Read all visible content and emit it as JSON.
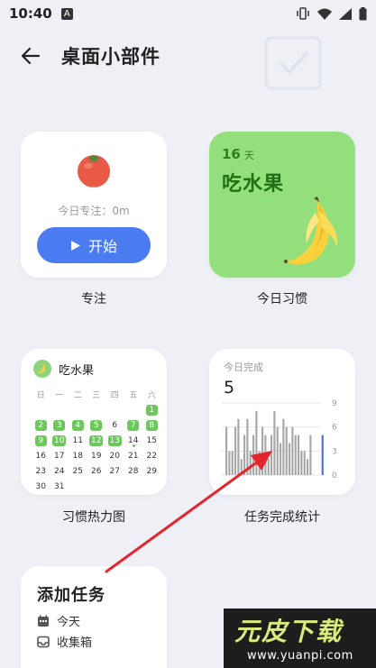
{
  "status_bar": {
    "time": "10:40",
    "notif_badge": "A"
  },
  "header": {
    "title": "桌面小部件"
  },
  "widgets": {
    "focus": {
      "caption": "专注",
      "focus_text": "今日专注：0m",
      "start_label": "开始"
    },
    "habit": {
      "caption": "今日习惯",
      "days": "16",
      "days_unit": "天",
      "name": "吃水果",
      "bg_color": "#92df7c"
    },
    "heatmap": {
      "caption": "习惯热力图",
      "title": "吃水果",
      "weekdays": [
        "日",
        "一",
        "二",
        "三",
        "四",
        "五",
        "六"
      ],
      "weeks": [
        [
          {
            "d": "",
            "done": false
          },
          {
            "d": "",
            "done": false
          },
          {
            "d": "",
            "done": false
          },
          {
            "d": "",
            "done": false
          },
          {
            "d": "",
            "done": false
          },
          {
            "d": "",
            "done": false
          },
          {
            "d": "1",
            "done": true
          }
        ],
        [
          {
            "d": "2",
            "done": true
          },
          {
            "d": "3",
            "done": true
          },
          {
            "d": "4",
            "done": true
          },
          {
            "d": "5",
            "done": true
          },
          {
            "d": "6",
            "done": false
          },
          {
            "d": "7",
            "done": true
          },
          {
            "d": "8",
            "done": true
          }
        ],
        [
          {
            "d": "9",
            "done": true
          },
          {
            "d": "10",
            "done": true
          },
          {
            "d": "11",
            "done": false
          },
          {
            "d": "12",
            "done": true
          },
          {
            "d": "13",
            "done": true
          },
          {
            "d": "14",
            "done": false,
            "today": true
          },
          {
            "d": "15",
            "done": false
          }
        ],
        [
          {
            "d": "16",
            "done": false
          },
          {
            "d": "17",
            "done": false
          },
          {
            "d": "18",
            "done": false
          },
          {
            "d": "19",
            "done": false
          },
          {
            "d": "20",
            "done": false
          },
          {
            "d": "21",
            "done": false
          },
          {
            "d": "22",
            "done": false
          }
        ],
        [
          {
            "d": "23",
            "done": false
          },
          {
            "d": "24",
            "done": false
          },
          {
            "d": "25",
            "done": false
          },
          {
            "d": "26",
            "done": false
          },
          {
            "d": "27",
            "done": false
          },
          {
            "d": "28",
            "done": false
          },
          {
            "d": "29",
            "done": false
          }
        ],
        [
          {
            "d": "30",
            "done": false
          },
          {
            "d": "31",
            "done": false
          },
          {
            "d": "",
            "done": false
          },
          {
            "d": "",
            "done": false
          },
          {
            "d": "",
            "done": false
          },
          {
            "d": "",
            "done": false
          },
          {
            "d": "",
            "done": false
          }
        ]
      ]
    },
    "stats": {
      "caption": "任务完成统计",
      "label": "今日完成",
      "value": "5"
    },
    "add_task": {
      "title": "添加任务",
      "rows": [
        {
          "label": "今天",
          "icon": "calendar-icon"
        },
        {
          "label": "收集箱",
          "icon": "inbox-icon"
        }
      ]
    }
  },
  "chart_data": {
    "type": "bar",
    "title": "今日完成",
    "y_ticks": [
      "9",
      "6",
      "3",
      "0"
    ],
    "ylim": [
      0,
      9
    ],
    "values": [
      6,
      3,
      3,
      6,
      7,
      2,
      5,
      7,
      3,
      5,
      8,
      3,
      6,
      5,
      2,
      5,
      8,
      6,
      4,
      7,
      6,
      4,
      6,
      5,
      5,
      3,
      3,
      2,
      5,
      5
    ],
    "highlight_last": true,
    "bar_color": "#a7a7a7",
    "highlight_color": "#4a6fd6"
  },
  "watermark": {
    "title": "元皮下载",
    "url": "www.yuanpi.com"
  }
}
